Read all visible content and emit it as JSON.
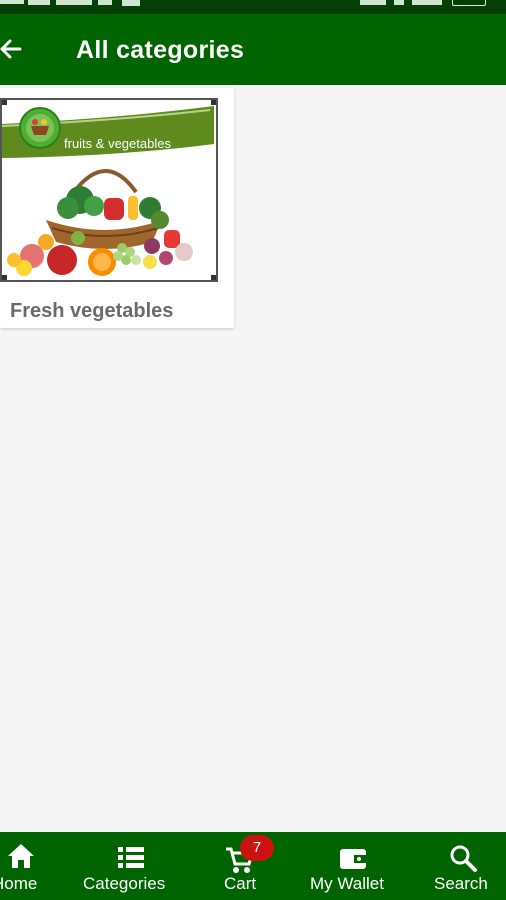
{
  "app_bar": {
    "title": "All categories"
  },
  "categories": [
    {
      "name": "Fresh vegetables",
      "banner_text": "fruits & vegetables"
    }
  ],
  "bottom_nav": {
    "items": [
      {
        "label": "Home",
        "icon": "home-icon"
      },
      {
        "label": "Categories",
        "icon": "list-icon"
      },
      {
        "label": "Cart",
        "icon": "cart-icon",
        "badge": "7"
      },
      {
        "label": "My Wallet",
        "icon": "wallet-icon"
      },
      {
        "label": "Search",
        "icon": "search-icon"
      }
    ]
  },
  "colors": {
    "primary": "#006400",
    "status_bar": "#063f06",
    "badge": "#cc1111",
    "background": "#f5f5f5"
  }
}
